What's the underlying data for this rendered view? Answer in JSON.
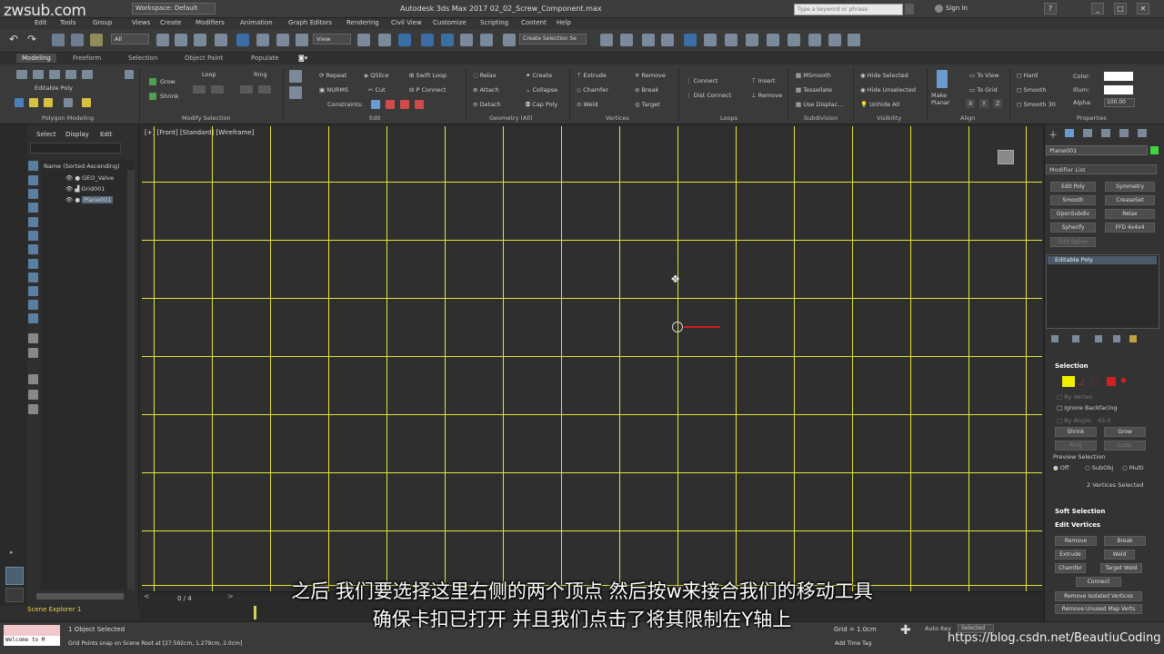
{
  "watermark": "zwsub.com",
  "titlebar": {
    "workspace": "Workspace: Default",
    "title": "Autodesk 3ds Max 2017    02_02_Screw_Component.max",
    "search_placeholder": "Type a keyword or phrase",
    "sign_in": "Sign In",
    "help": "?",
    "minimize": "_",
    "maximize": "□",
    "close": "✕"
  },
  "menus": [
    "Edit",
    "Tools",
    "Group",
    "Views",
    "Create",
    "Modifiers",
    "Animation",
    "Graph Editors",
    "Rendering",
    "Civil View",
    "Customize",
    "Scripting",
    "Content",
    "Help"
  ],
  "toolbar": {
    "filter": "All",
    "view": "View",
    "selection_set": "Create Selection Se"
  },
  "ribbon_tabs": [
    "Modeling",
    "Freeform",
    "Selection",
    "Object Paint",
    "Populate"
  ],
  "ribbon": {
    "editable_poly": "Editable Poly",
    "polygon_modeling": "Polygon Modeling",
    "modify_selection": "Modify Selection",
    "grow": "Grow",
    "shrink": "Shrink",
    "loop": "Loop",
    "ring": "Ring",
    "edit_section": "Edit",
    "repeat": "Repeat",
    "qslice": "QSlice",
    "swift_loop": "Swift Loop",
    "nurms": "NURMS",
    "cut": "Cut",
    "p_connect": "P Connect",
    "constraints": "Constraints:",
    "geometry_section": "Geometry (All)",
    "relax": "Relax",
    "create": "Create",
    "attach": "Attach",
    "collapse": "Collapse",
    "detach": "Detach",
    "cap_poly": "Cap Poly",
    "vertices_section": "Vertices",
    "extrude": "Extrude",
    "remove": "Remove",
    "chamfer": "Chamfer",
    "break": "Break",
    "weld": "Weld",
    "target": "Target",
    "loops_section": "Loops",
    "connect": "Connect",
    "dist_connect": "Dist Connect",
    "insert": "Insert",
    "remove_loop": "Remove",
    "subdivision_section": "Subdivision",
    "msmooth": "MSmooth",
    "tessellate": "Tessellate",
    "use_displac": "Use Displac...",
    "visibility_section": "Visibility",
    "hide_selected": "Hide Selected",
    "hide_unselected": "Hide Unselected",
    "unhide_all": "Unhide All",
    "align_section": "Align",
    "make_planar": "Make Planar",
    "to_view": "To View",
    "to_grid": "To Grid",
    "x": "X",
    "y": "Y",
    "z": "Z",
    "hard": "Hard",
    "smooth": "Smooth",
    "smooth30": "Smooth 30",
    "properties_section": "Properties",
    "color": "Color:",
    "illum": "Illum:",
    "alpha": "Alpha:",
    "alpha_val": "100.00"
  },
  "explorer": {
    "tab_select": "Select",
    "tab_display": "Display",
    "tab_edit": "Edit",
    "header": "Name (Sorted Ascending)",
    "items": [
      "GEO_Valve",
      "Grid001",
      "Plane001"
    ],
    "footer": "Scene Explorer 1"
  },
  "viewport": {
    "label": "[+] [Front] [Standard] [Wireframe]"
  },
  "command_panel": {
    "object_name": "Plane001",
    "modifier_list": "Modifier List",
    "modifiers": [
      "Edit Poly",
      "Symmetry",
      "Smooth",
      "CreaseSet",
      "OpenSubdiv",
      "Relax",
      "Spherify",
      "FFD 4x4x4",
      "Edit Spline"
    ],
    "stack_item": "Editable Poly",
    "selection_head": "Selection",
    "by_vertex": "By Vertex",
    "ignore_backfacing": "Ignore Backfacing",
    "by_angle": "By Angle:",
    "angle_val": "45.0",
    "shrink": "Shrink",
    "grow": "Grow",
    "ring": "Ring",
    "loop": "Loop",
    "preview_selection": "Preview Selection",
    "off": "Off",
    "subobj": "SubObj",
    "multi": "Multi",
    "vertices_selected": "2 Vertices Selected",
    "soft_selection": "Soft Selection",
    "edit_vertices": "Edit Vertices",
    "remove": "Remove",
    "break": "Break",
    "extrude": "Extrude",
    "weld": "Weld",
    "chamfer": "Chamfer",
    "target_weld": "Target Weld",
    "connect": "Connect",
    "remove_isolated": "Remove Isolated Vertices",
    "remove_unused": "Remove Unused Map Verts"
  },
  "timeline": {
    "frame": "0 / 4"
  },
  "status": {
    "welcome": "Welcome to M",
    "selection": "1 Object Selected",
    "prompt": "Grid Points snap on Scene Root at [27.592cm, 1.279cm, 2.0cm]",
    "grid": "Grid = 1.0cm",
    "add_time_tag": "Add Time Tag",
    "auto_key": "Auto Key",
    "selected": "Selected",
    "url": "https://blog.csdn.net/BeautiuCoding"
  },
  "subtitles": {
    "line1": "之后  我们要选择这里右侧的两个顶点  然后按w来接合我们的移动工具",
    "line2": "确保卡扣已打开  并且我们点击了将其限制在Y轴上"
  },
  "colors": {
    "grid": "#e4e43a",
    "viewport_bg": "#2f2f2f",
    "accent_green": "#3fd63f"
  }
}
